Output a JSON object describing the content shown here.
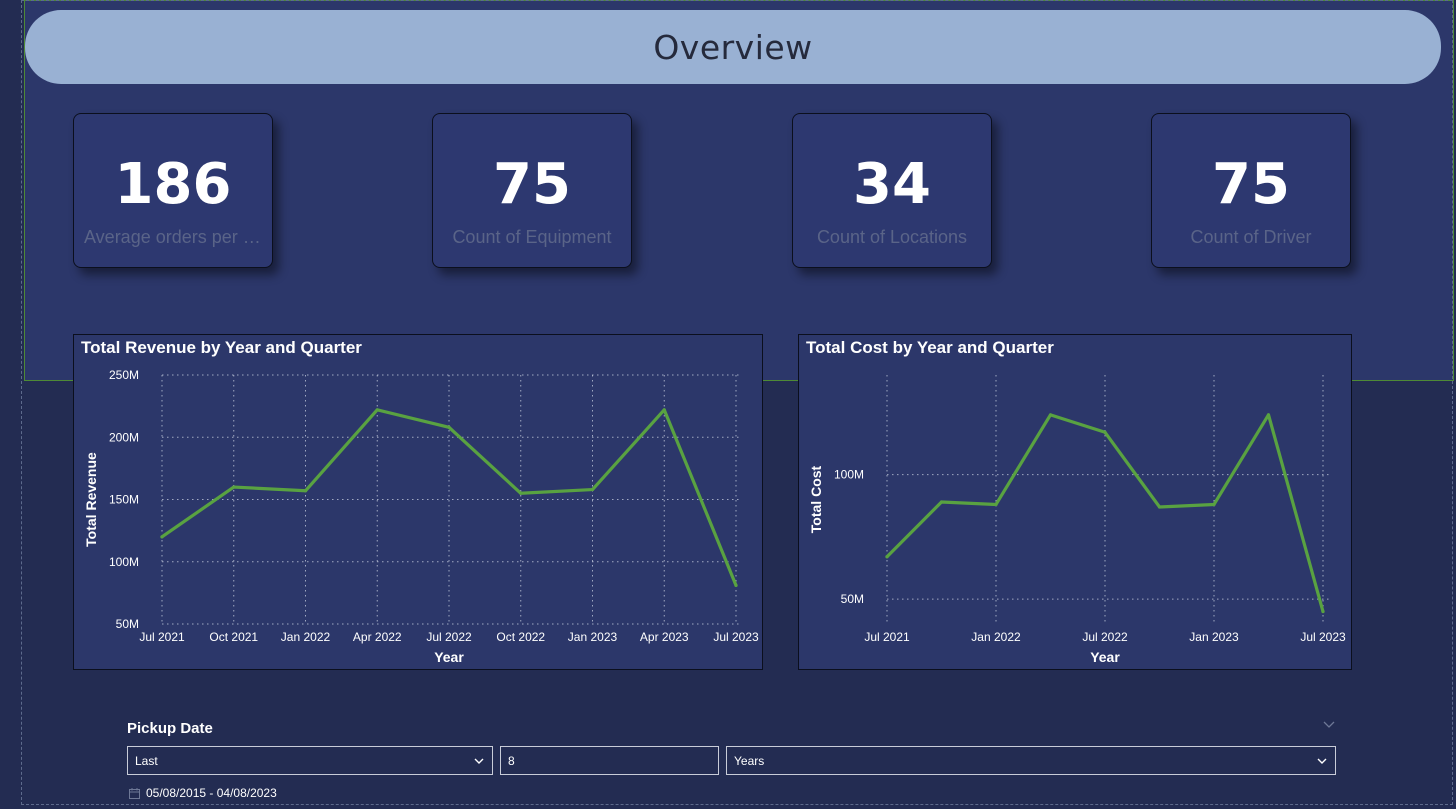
{
  "header": {
    "title": "Overview"
  },
  "kpis": [
    {
      "value": "186",
      "label": "Average orders per d..."
    },
    {
      "value": "75",
      "label": "Count of Equipment"
    },
    {
      "value": "34",
      "label": "Count of Locations"
    },
    {
      "value": "75",
      "label": "Count of Driver"
    }
  ],
  "colors": {
    "line": "#59a241",
    "band": "#2c376a",
    "background": "#232c52",
    "header": "#99b1d3"
  },
  "chart_data": [
    {
      "type": "line",
      "title": "Total Revenue by Year and Quarter",
      "xlabel": "Year",
      "ylabel": "Total Revenue",
      "x": [
        "Jul 2021",
        "Oct 2021",
        "Jan 2022",
        "Apr 2022",
        "Jul 2022",
        "Oct 2022",
        "Jan 2023",
        "Apr 2023",
        "Jul 2023"
      ],
      "series": [
        {
          "values": [
            120,
            160,
            157,
            222,
            208,
            155,
            158,
            222,
            81
          ]
        }
      ],
      "ylim": [
        50,
        250
      ],
      "y_ticks": [
        50,
        100,
        150,
        200,
        250
      ],
      "y_tick_labels": [
        "50M",
        "100M",
        "150M",
        "200M",
        "250M"
      ],
      "x_tick_labels": [
        "Jul 2021",
        "Oct 2021",
        "Jan 2022",
        "Apr 2022",
        "Jul 2022",
        "Oct 2022",
        "Jan 2023",
        "Apr 2023",
        "Jul 2023"
      ],
      "grid": true
    },
    {
      "type": "line",
      "title": "Total Cost by Year and Quarter",
      "xlabel": "Year",
      "ylabel": "Total Cost",
      "x": [
        "Jul 2021",
        "Oct 2021",
        "Jan 2022",
        "Apr 2022",
        "Jul 2022",
        "Oct 2022",
        "Jan 2023",
        "Apr 2023",
        "Jul 2023"
      ],
      "series": [
        {
          "values": [
            67,
            89,
            88,
            124,
            117,
            87,
            88,
            124,
            45
          ]
        }
      ],
      "ylim": [
        40,
        140
      ],
      "y_ticks": [
        50,
        100
      ],
      "y_tick_labels": [
        "50M",
        "100M"
      ],
      "x_tick_labels": [
        "Jul 2021",
        "Jan 2022",
        "Jul 2022",
        "Jan 2023",
        "Jul 2023"
      ],
      "x_tick_indices": [
        0,
        2,
        4,
        6,
        8
      ],
      "grid": true
    }
  ],
  "slicer": {
    "title": "Pickup Date",
    "relative_option": "Last",
    "count": "8",
    "unit": "Years",
    "date_range": "05/08/2015 - 04/08/2023"
  }
}
